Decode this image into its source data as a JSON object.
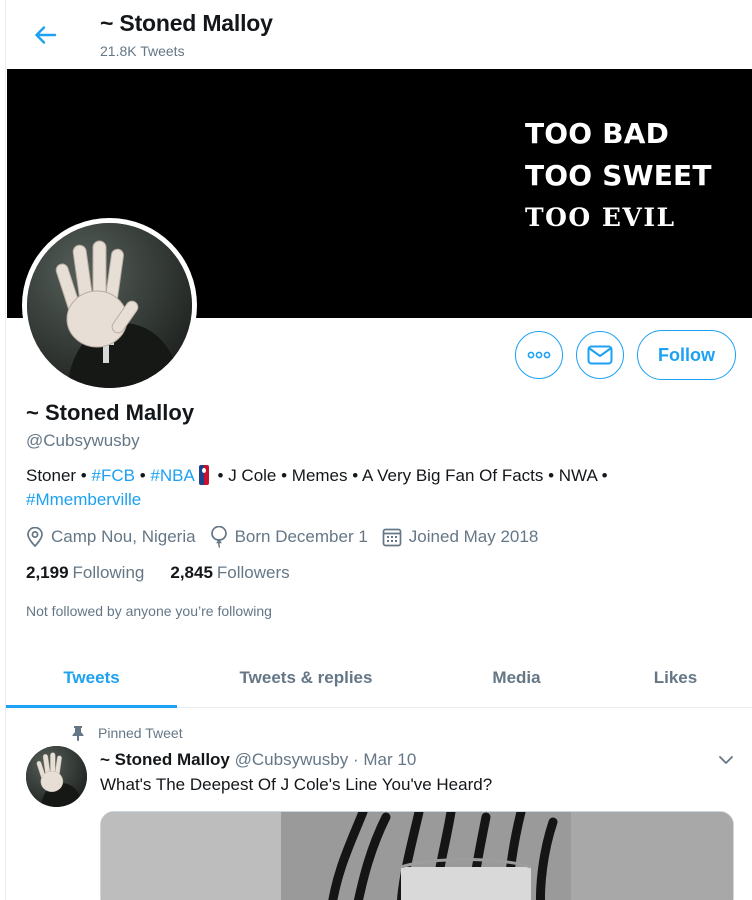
{
  "header": {
    "title": "~ Stoned Malloy",
    "tweet_count": "21.8K Tweets"
  },
  "banner": {
    "lines": [
      "TOO BAD",
      "TOO SWEET",
      "TOO EVIL"
    ]
  },
  "actions": {
    "follow_label": "Follow"
  },
  "profile": {
    "display_name": "~ Stoned Malloy",
    "handle": "@Cubsywusby",
    "bio": {
      "p1": "Stoner • ",
      "tag1": "#FCB",
      "p2": " • ",
      "tag2": "#NBA",
      "p3": " • J Cole • Memes • A Very Big Fan Of Facts • NWA • ",
      "tag3": "#Mmemberville"
    },
    "location": "Camp Nou, Nigeria",
    "born": "Born December 1",
    "joined": "Joined May 2018",
    "following_count": "2,199",
    "following_label": "Following",
    "followers_count": "2,845",
    "followers_label": "Followers",
    "followed_note": "Not followed by anyone you’re following"
  },
  "tabs": [
    {
      "label": "Tweets",
      "active": true
    },
    {
      "label": "Tweets & replies",
      "active": false
    },
    {
      "label": "Media",
      "active": false
    },
    {
      "label": "Likes",
      "active": false
    }
  ],
  "pinned_tweet": {
    "pinned_label": "Pinned Tweet",
    "author_name": "~ Stoned Malloy",
    "author_handle": "@Cubsywusby",
    "separator": " · ",
    "date": "Mar 10",
    "text": "What's The Deepest Of J Cole's Line You've Heard?"
  },
  "colors": {
    "accent": "#1da1f2",
    "secondary_text": "#657786",
    "primary_text": "#14171a",
    "banner_bg": "#000000"
  },
  "icons": {
    "back": "arrow-left-icon",
    "more": "more-dots-icon",
    "message": "envelope-icon",
    "location": "location-pin-icon",
    "born": "balloon-icon",
    "joined": "calendar-icon",
    "pin": "pin-icon",
    "caret": "chevron-down-icon"
  }
}
